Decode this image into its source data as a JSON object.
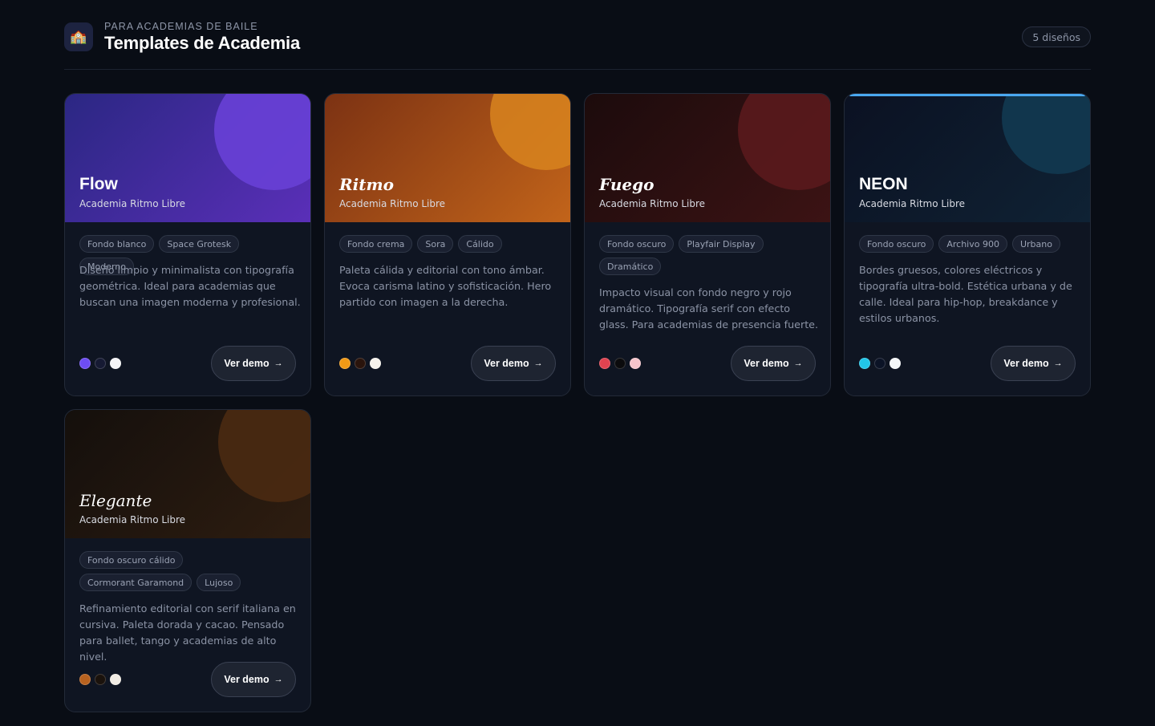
{
  "header": {
    "logo_icon": "🏫",
    "eyebrow": "PARA ACADEMIAS DE BAILE",
    "title": "Templates de Academia",
    "count_badge": "5 diseños"
  },
  "cards": [
    {
      "name": "Flow",
      "subtitle": "Academia Ritmo Libre",
      "tags": [
        "Fondo blanco",
        "Space Grotesk",
        "Moderno"
      ],
      "description": "Diseño limpio y minimalista con tipografía geométrica. Ideal para academias que buscan una imagen moderna y profesional.",
      "swatches": [
        "#6d4df2",
        "#161a33",
        "#f4f4f6"
      ],
      "button": "Ver demo",
      "colors": {
        "hero_from": "#2b2783",
        "hero_to": "#5a2fb8",
        "circle": "#6840d6"
      }
    },
    {
      "name": "Ritmo",
      "subtitle": "Academia Ritmo Libre",
      "tags": [
        "Fondo crema",
        "Sora",
        "Cálido"
      ],
      "description": "Paleta cálida y editorial con tono ámbar. Evoca carisma latino y sofisticación. Hero partido con imagen a la derecha.",
      "swatches": [
        "#f19a16",
        "#2a140c",
        "#f6f2ec"
      ],
      "button": "Ver demo",
      "colors": {
        "hero_from": "#7c3213",
        "hero_to": "#c2641a",
        "circle": "#d8841f"
      }
    },
    {
      "name": "Fuego",
      "subtitle": "Academia Ritmo Libre",
      "tags": [
        "Fondo oscuro",
        "Playfair Display",
        "Dramático"
      ],
      "description": "Impacto visual con fondo negro y rojo dramático. Tipografía serif con efecto glass. Para academias de presencia fuerte.",
      "swatches": [
        "#e04350",
        "#0b0b0d",
        "#f6c5cc"
      ],
      "button": "Ver demo",
      "colors": {
        "hero_from": "#1c0b0c",
        "hero_to": "#3c1314",
        "circle": "#5a1a1d"
      }
    },
    {
      "name": "NEON",
      "subtitle": "Academia Ritmo Libre",
      "tags": [
        "Fondo oscuro",
        "Archivo 900",
        "Urbano"
      ],
      "description": "Bordes gruesos, colores eléctricos y tipografía ultra-bold. Estética urbana y de calle. Ideal para hip-hop, breakdance y estilos urbanos.",
      "swatches": [
        "#22c5e8",
        "#0b1326",
        "#f4f6f8"
      ],
      "button": "Ver demo",
      "colors": {
        "hero_from": "#0b1122",
        "hero_to": "#0f2234",
        "circle": "#12384f",
        "top_line": "#4aa8f0"
      }
    },
    {
      "name": "Elegante",
      "subtitle": "Academia Ritmo Libre",
      "tags": [
        "Fondo oscuro cálido",
        "Cormorant Garamond",
        "Lujoso"
      ],
      "description": "Refinamiento editorial con serif italiana en cursiva. Paleta dorada y cacao. Pensado para ballet, tango y academias de alto nivel.",
      "swatches": [
        "#b8621f",
        "#1a120c",
        "#f1ece4"
      ],
      "button": "Ver demo",
      "colors": {
        "hero_from": "#140f0c",
        "hero_to": "#2e1d10",
        "circle": "#4a2a12"
      }
    }
  ]
}
